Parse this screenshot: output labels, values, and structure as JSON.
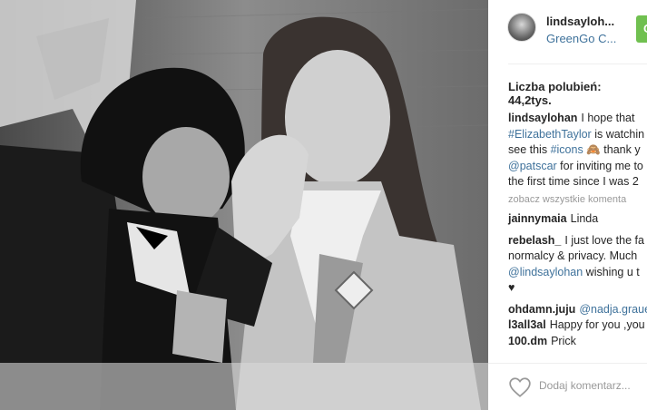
{
  "post": {
    "username": "lindsaylohan",
    "username_display": "lindsayloh...",
    "location": "GreenGo C...",
    "follow_label": "O",
    "likes_label": "Liczba polubień:",
    "likes_count": "44,2tys.",
    "caption_lines": [
      {
        "user": "lindsaylohan",
        "text": "I hope that"
      },
      {
        "link": "#ElizabethTaylor",
        "text": "is watchin"
      },
      {
        "text": "see this",
        "link": "#icons",
        "after": "thank y"
      },
      {
        "link": "@patscar",
        "text": "for inviting me to"
      },
      {
        "text": "the first time since I was 2"
      }
    ],
    "view_all_label": "zobacz wszystkie komenta",
    "comments": [
      {
        "user": "jainnymaia",
        "text": "Linda"
      },
      {
        "user": "rebelash_",
        "text": "I just love the fa"
      },
      {
        "text": "normalcy & privacy. Much"
      },
      {
        "link": "@lindsaylohan",
        "text": "wishing u t"
      },
      {
        "text": "♥"
      },
      {
        "user": "ohdamn.juju",
        "link": "@nadja.graue"
      },
      {
        "user": "l3all3al",
        "text": "Happy for you ,you"
      },
      {
        "user": "100.dm",
        "text": "Prick"
      }
    ],
    "add_comment_placeholder": "Dodaj komentarz..."
  },
  "icons": {
    "heart": "heart-icon",
    "avatar": "avatar",
    "emoji": "monkey-emoji"
  },
  "colors": {
    "link": "#3f729b",
    "text": "#262626",
    "muted": "#999999",
    "follow": "#70c050"
  }
}
